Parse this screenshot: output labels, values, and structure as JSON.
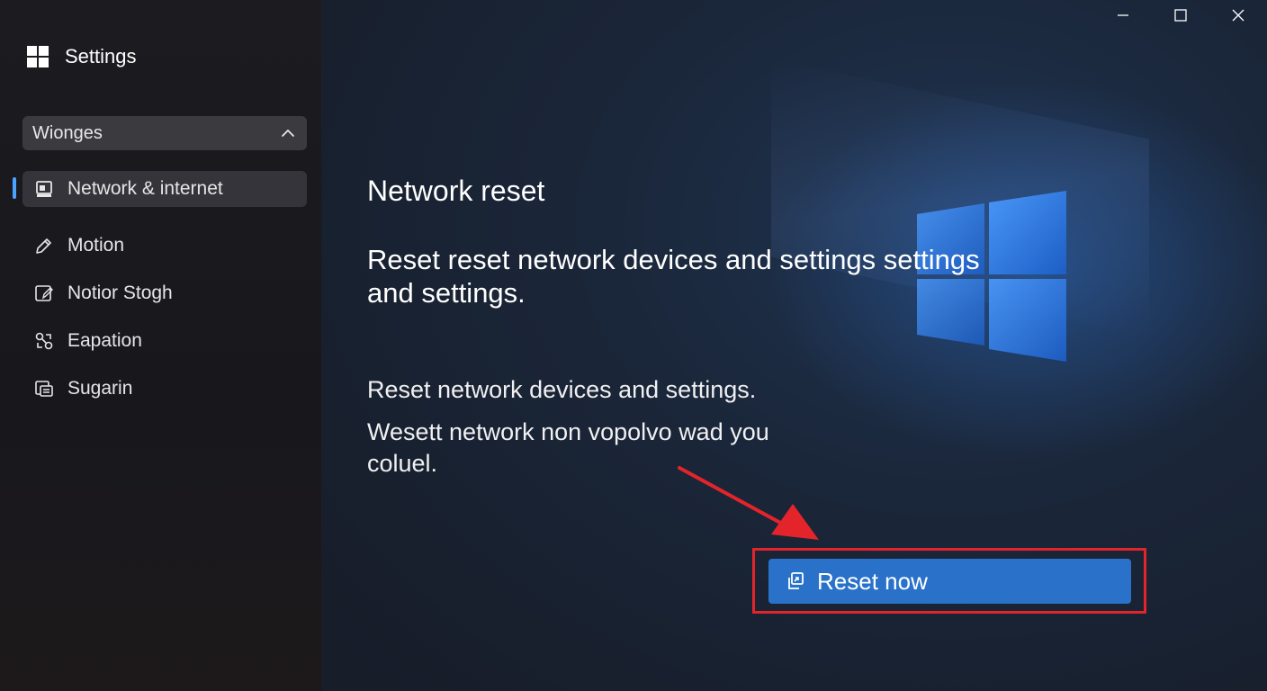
{
  "app": {
    "title": "Settings",
    "logo_icon": "windows-logo-icon"
  },
  "window_controls": {
    "minimize_icon": "minimize-icon",
    "maximize_icon": "maximize-icon",
    "close_icon": "close-icon"
  },
  "sidebar": {
    "dropdown": {
      "label": "Wionges",
      "icon": "chevron-up-icon"
    },
    "items": [
      {
        "label": "Network & internet",
        "icon": "network-icon",
        "active": true
      },
      {
        "label": "Motion",
        "icon": "pen-icon"
      },
      {
        "label": "Notior Stogh",
        "icon": "edit-window-icon"
      },
      {
        "label": "Eapation",
        "icon": "link-icon"
      },
      {
        "label": "Sugarin",
        "icon": "storage-icon"
      }
    ]
  },
  "main": {
    "heading": "Network reset",
    "lead": "Reset reset network devices and settings settings and settings.",
    "paragraph1": "Reset network devices and settings.",
    "paragraph2": "Wesett network non vopolvo wad you coluel.",
    "reset_button": {
      "label": "Reset now",
      "icon": "reset-icon"
    },
    "annotation": {
      "color": "#e3242b",
      "arrow_icon": "red-arrow-icon"
    },
    "hero_icon": "windows-logo-icon"
  },
  "colors": {
    "accent": "#2a72c9",
    "indicator": "#4aa3ff",
    "annotation": "#e3242b"
  }
}
